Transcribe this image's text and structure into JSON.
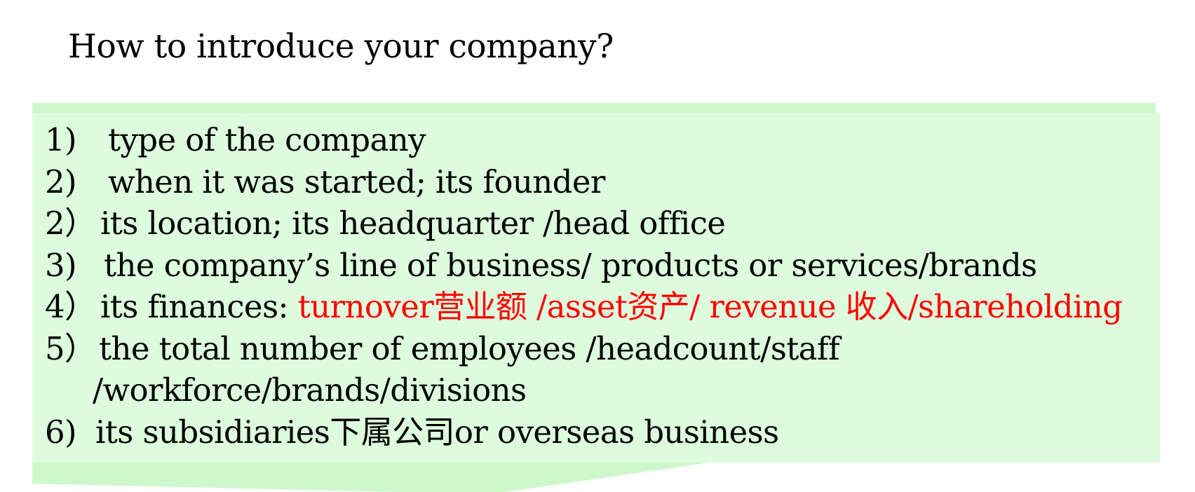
{
  "title": "How to introduce your company?",
  "colors": {
    "panel_fill": "#ddfcdd",
    "panel_edge": "#ccf8cc",
    "highlight": "#ff0000",
    "text": "#000000"
  },
  "items": [
    {
      "number": "1)",
      "text": "type of the company"
    },
    {
      "number": "2)",
      "text": "when it was started; its founder"
    },
    {
      "number": "2）",
      "text": "its location;  its headquarter /head office"
    },
    {
      "number": "3)",
      "text": "the company’s line of business/ products or services/brands"
    },
    {
      "number": "4）",
      "text": "its finances: ",
      "highlight": "turnover营业额 /asset资产/ revenue 收入/shareholding"
    },
    {
      "number": "5）",
      "text": "the total number of employees /headcount/staff",
      "continuation": "/workforce/brands/divisions"
    },
    {
      "number": "6)",
      "text": "its subsidiaries下属公司or overseas business"
    }
  ]
}
